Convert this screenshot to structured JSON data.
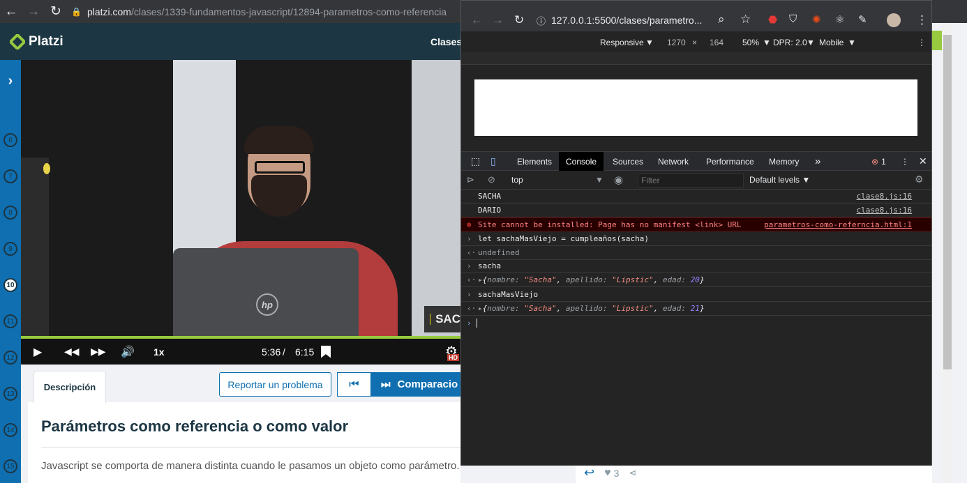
{
  "main_browser": {
    "url_host": "platzi.com",
    "url_path": "/clases/1339-fundamentos-javascript/12894-parametros-como-referencia"
  },
  "header": {
    "logo_text": "Platzi",
    "clases_label": "Clases"
  },
  "rail": {
    "items": [
      "6",
      "7",
      "8",
      "9",
      "10",
      "11",
      "12",
      "13",
      "14",
      "15"
    ],
    "active": "10"
  },
  "video": {
    "overlay_tag": "SAC",
    "laptop_logo": "hp",
    "speed": "1x",
    "time_current": "5:36",
    "time_separator": "/",
    "time_total": "6:15",
    "hd_badge": "HD"
  },
  "lesson": {
    "tab_description": "Descripción",
    "report_button": "Reportar un problema",
    "next_button": "Comparacio",
    "title": "Parámetros como referencia o como valor",
    "paragraph": "Javascript se comporta de manera distinta cuando le pasamos un objeto como parámetro."
  },
  "comments": {
    "likes": "3"
  },
  "devtools": {
    "url": "127.0.0.1:5500/clases/parametro...",
    "device": "Responsive",
    "width": "1270",
    "times": "×",
    "height": "164",
    "zoom": "50%",
    "dpr": "DPR: 2.0",
    "mode": "Mobile",
    "tabs": [
      "Elements",
      "Console",
      "Sources",
      "Network",
      "Performance",
      "Memory"
    ],
    "active_tab": "Console",
    "more_tabs": "»",
    "error_count": "1",
    "context": "top",
    "filter_placeholder": "Filter",
    "levels": "Default levels ▼",
    "console": [
      {
        "text": "SACHA",
        "source": "clase8.js:16"
      },
      {
        "text": "DARIO",
        "source": "clase8.js:16"
      },
      {
        "text": "Site cannot be installed: Page has no manifest <link> URL",
        "source": "parametros-como-referncia.html:1"
      },
      {
        "text": "let sachaMasViejo = cumpleaños(sacha)"
      },
      {
        "text": "undefined"
      },
      {
        "text": "sacha"
      },
      {
        "text": "sachaMasViejo"
      }
    ],
    "obj1": {
      "nombre": "\"Sacha\"",
      "apellido": "\"Lipstic\"",
      "edad": "20"
    },
    "obj2": {
      "nombre": "\"Sacha\"",
      "apellido": "\"Lipstic\"",
      "edad": "21"
    },
    "keys": {
      "nombre": "nombre: ",
      "apellido": "apellido: ",
      "edad": "edad: "
    }
  },
  "colors": {
    "platzi_dark": "#1c3643",
    "platzi_blue": "#0f6fb1",
    "platzi_green": "#98ca3f",
    "devtools_bg": "#242424"
  }
}
